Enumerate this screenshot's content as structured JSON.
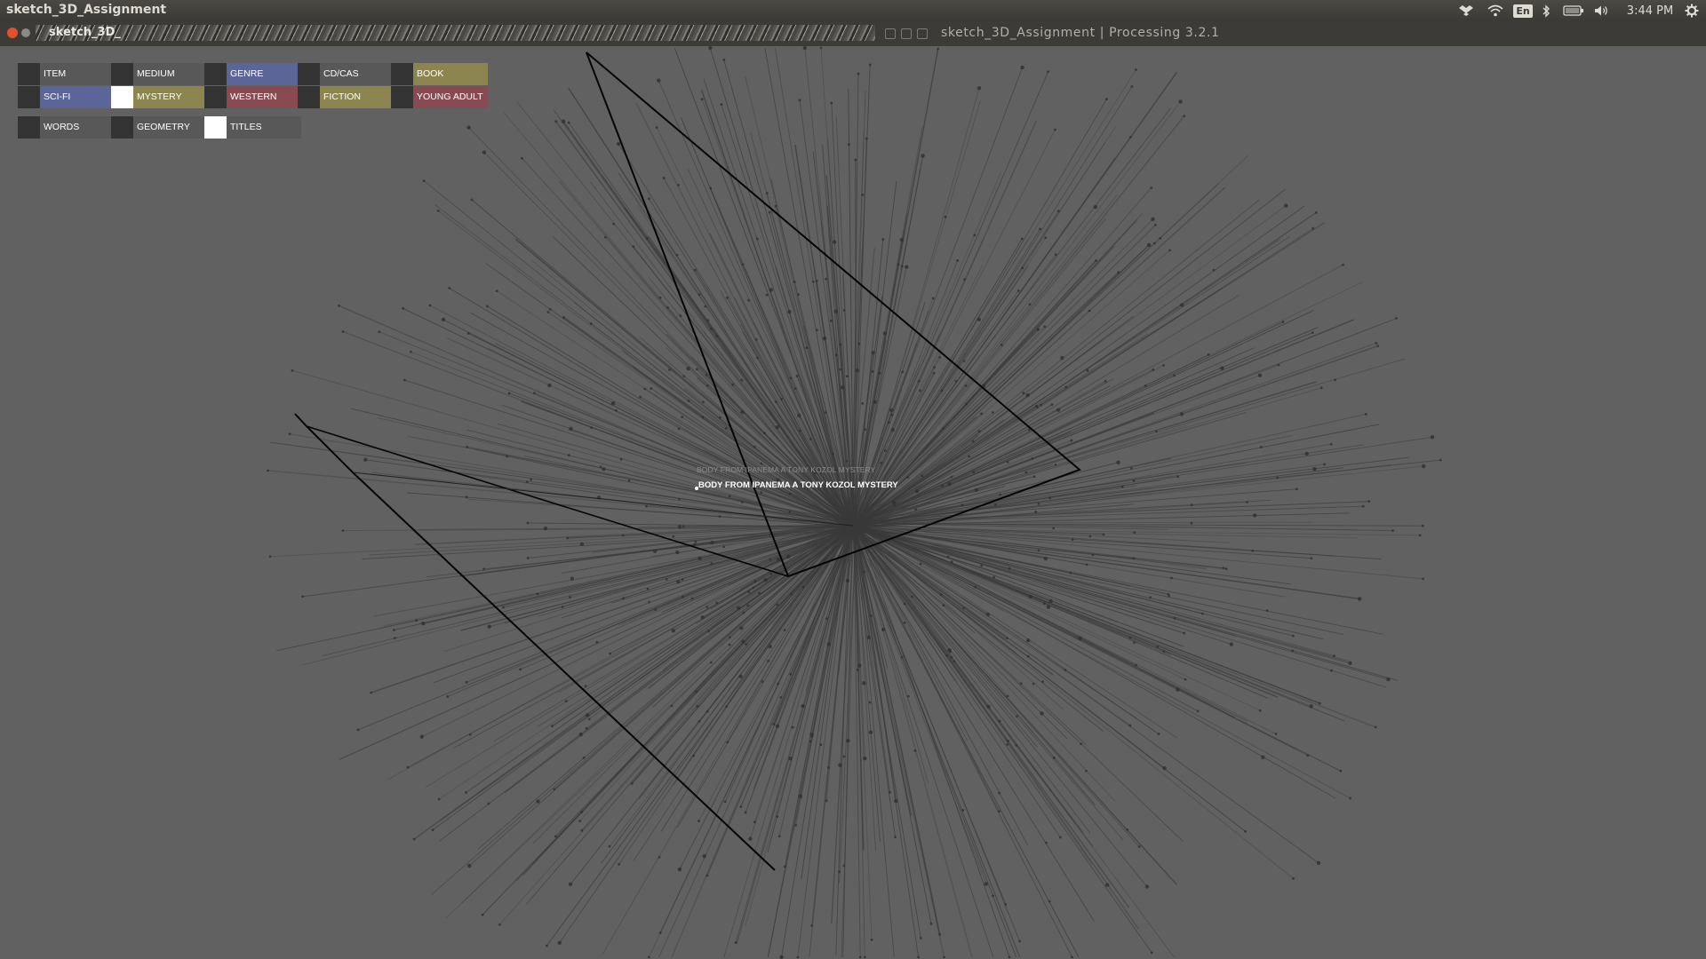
{
  "topbar": {
    "app_name": "sketch_3D_Assignment",
    "keyboard_layout": "En",
    "clock": "3:44 PM",
    "tray_icons": [
      "dropbox-icon",
      "wifi-icon",
      "keyboard-icon",
      "bluetooth-icon",
      "battery-icon",
      "volume-icon",
      "settings-gear-icon"
    ]
  },
  "window": {
    "title": "sketch_3D_Assignment | Processing 3.2.1",
    "partial_app_title": "sketch_3D_"
  },
  "controls": {
    "row1": [
      {
        "label": "ITEM",
        "active": false,
        "color": "#585858"
      },
      {
        "label": "MEDIUM",
        "active": false,
        "color": "#585858"
      },
      {
        "label": "GENRE",
        "active": false,
        "color": "#5c6598"
      },
      {
        "label": "CD/CAS",
        "active": false,
        "color": "#585858"
      },
      {
        "label": "BOOK",
        "active": false,
        "color": "#8c8550"
      }
    ],
    "row2": [
      {
        "label": "SCI-FI",
        "active": false,
        "color": "#5c6598"
      },
      {
        "label": "MYSTERY",
        "active": true,
        "color": "#8c8550"
      },
      {
        "label": "WESTERN",
        "active": false,
        "color": "#8a4a52"
      },
      {
        "label": "FICTION",
        "active": false,
        "color": "#8c8550"
      },
      {
        "label": "YOUNG ADULT",
        "active": false,
        "color": "#8a4a52"
      }
    ],
    "row3": [
      {
        "label": "WORDS",
        "active": false,
        "color": "#585858"
      },
      {
        "label": "GEOMETRY",
        "active": false,
        "color": "#585858"
      },
      {
        "label": "TITLES",
        "active": true,
        "color": "#585858"
      }
    ]
  },
  "visualization": {
    "hover_title": "BODY FROM IPANEMA A TONY KOZOL MYSTERY",
    "hover_title_echo": "BODY FROM IPANEMA A TONY KOZOL MYSTERY"
  },
  "colors": {
    "background": "#616161",
    "switch_off": "#333333",
    "switch_on": "#ffffff",
    "ray": "#3a3a3a"
  }
}
